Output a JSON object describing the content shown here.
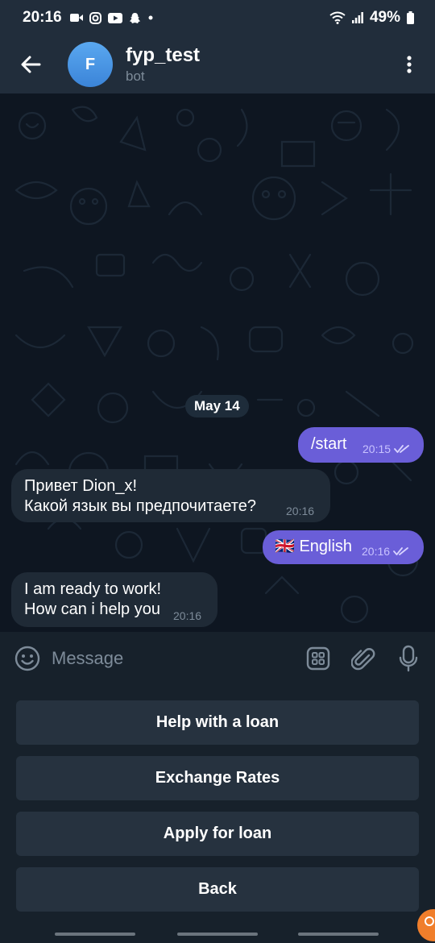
{
  "status_bar": {
    "time": "20:16",
    "battery": "49%"
  },
  "header": {
    "avatar_letter": "F",
    "title": "fyp_test",
    "subtitle": "bot"
  },
  "chat": {
    "date_label": "May 14",
    "messages": [
      {
        "direction": "out",
        "text": "/start",
        "time": "20:15",
        "read": true
      },
      {
        "direction": "in",
        "text": "Привет Dion_x!\nКакой язык вы предпочитаете?",
        "time": "20:16"
      },
      {
        "direction": "out",
        "text": "🇬🇧 English",
        "time": "20:16",
        "read": true
      },
      {
        "direction": "in",
        "text": "I am ready to work!\nHow can i help you",
        "time": "20:16"
      }
    ]
  },
  "composer": {
    "placeholder": "Message"
  },
  "keyboard": {
    "buttons": [
      "Help with a loan",
      "Exchange Rates",
      "Apply for loan",
      "Back"
    ]
  },
  "colors": {
    "accent_outgoing": "#6a5ed8",
    "incoming_bubble": "#1f2a36",
    "background": "#0e1621",
    "header": "#212d3b",
    "avatar": "#4a97e6"
  }
}
